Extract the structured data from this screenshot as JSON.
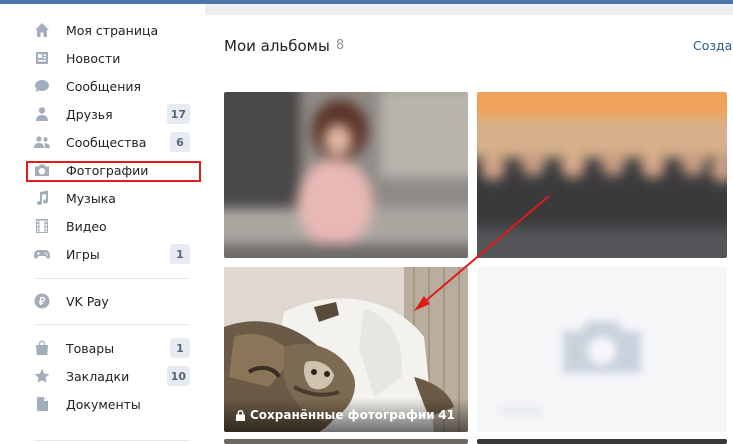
{
  "sidebar": {
    "items": [
      {
        "label": "Моя страница",
        "icon": "home-icon"
      },
      {
        "label": "Новости",
        "icon": "news-icon"
      },
      {
        "label": "Сообщения",
        "icon": "chat-icon"
      },
      {
        "label": "Друзья",
        "icon": "person-icon",
        "badge": "17"
      },
      {
        "label": "Сообщества",
        "icon": "group-icon",
        "badge": "6"
      },
      {
        "label": "Фотографии",
        "icon": "camera-icon"
      },
      {
        "label": "Музыка",
        "icon": "music-note-icon"
      },
      {
        "label": "Видео",
        "icon": "film-icon"
      },
      {
        "label": "Игры",
        "icon": "gamepad-icon",
        "badge": "1"
      },
      {
        "label": "VK Pay",
        "icon": "ruble-coin-icon"
      },
      {
        "label": "Товары",
        "icon": "shopping-bag-icon",
        "badge": "1"
      },
      {
        "label": "Закладки",
        "icon": "star-icon",
        "badge": "10"
      },
      {
        "label": "Документы",
        "icon": "document-icon"
      }
    ]
  },
  "main": {
    "title": "Мои альбомы",
    "count": "8",
    "create_label": "Создат",
    "albums": [
      {
        "name": "Сохранённые фотографии",
        "count": "41"
      }
    ]
  },
  "colors": {
    "brand": "#4a76a8",
    "highlight": "#e11a1a",
    "icon": "#a3adbb",
    "link": "#2a5885"
  }
}
